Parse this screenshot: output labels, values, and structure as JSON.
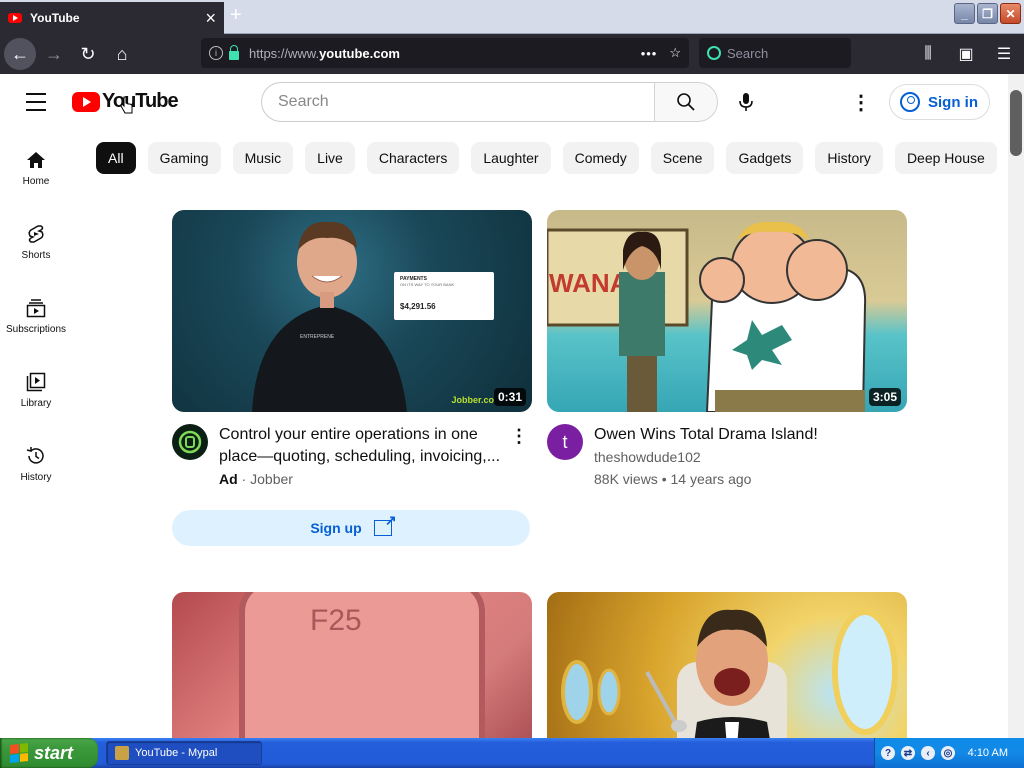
{
  "browser": {
    "tab_title": "YouTube",
    "url_prefix": "https://www.",
    "url_host": "youtube.com",
    "search_placeholder": "Search"
  },
  "header": {
    "logo_text": "YouTube",
    "search_placeholder": "Search",
    "signin_label": "Sign in"
  },
  "sidenav": [
    {
      "label": "Home",
      "icon": "home-icon"
    },
    {
      "label": "Shorts",
      "icon": "shorts-icon"
    },
    {
      "label": "Subscriptions",
      "icon": "subscriptions-icon"
    },
    {
      "label": "Library",
      "icon": "library-icon"
    },
    {
      "label": "History",
      "icon": "history-icon"
    }
  ],
  "chips": [
    "All",
    "Gaming",
    "Music",
    "Live",
    "Characters",
    "Laughter",
    "Comedy",
    "Scene",
    "Gadgets",
    "History",
    "Deep House"
  ],
  "videos": [
    {
      "title": "Control your entire operations in one place—quoting, scheduling, invoicing,...",
      "ad_label": "Ad",
      "channel": "Jobber",
      "duration": "0:31",
      "thumb_card_title": "PAYMENTS",
      "thumb_card_sub": "ON ITS WAY TO YOUR BANK",
      "thumb_card_amount": "$4,291.56",
      "thumb_brand": "Jobber.co",
      "cta_label": "Sign up"
    },
    {
      "title": "Owen Wins Total Drama Island!",
      "channel": "theshowdude102",
      "channel_initial": "t",
      "stats": "88K views • 14 years ago",
      "duration": "3:05",
      "thumb_text": "WANAKA"
    },
    {
      "thumb_text": "F25"
    },
    {}
  ],
  "taskbar": {
    "start_label": "start",
    "task_label": "YouTube - Mypal",
    "clock": "4:10 AM"
  },
  "colors": {
    "youtube_red": "#ff0000",
    "link_blue": "#065fd4",
    "chip_active": "#0f0f0f"
  }
}
